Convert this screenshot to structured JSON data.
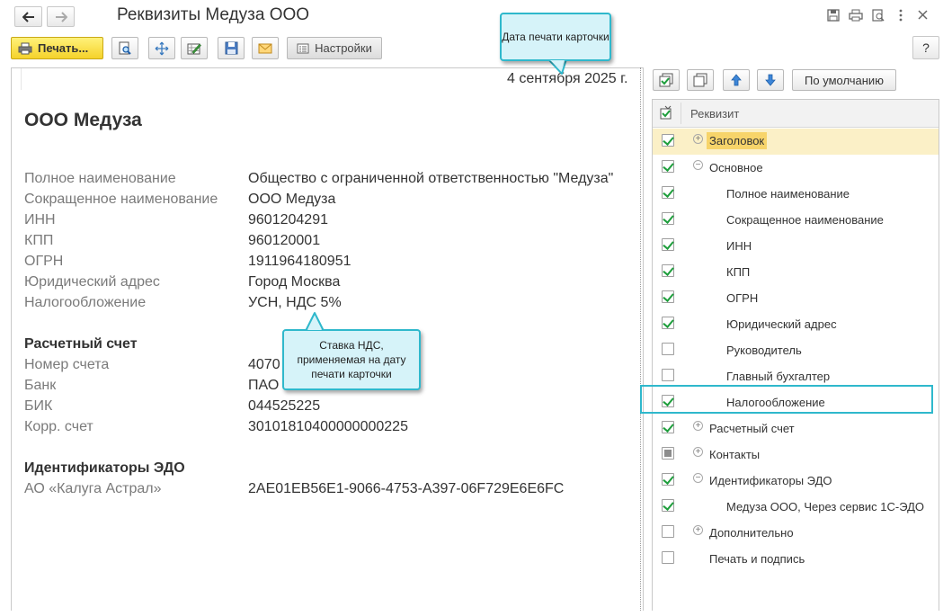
{
  "window": {
    "title": "Реквизиты Медуза ООО"
  },
  "toolbar": {
    "print_label": "Печать...",
    "settings_label": "Настройки",
    "help_label": "?"
  },
  "document": {
    "date": "4 сентября 2025 г.",
    "company": "ООО Медуза",
    "fields": [
      {
        "label": "Полное наименование",
        "value": "Общество с ограниченной ответственностью \"Медуза\""
      },
      {
        "label": "Сокращенное наименование",
        "value": "ООО Медуза"
      },
      {
        "label": "ИНН",
        "value": "9601204291"
      },
      {
        "label": "КПП",
        "value": "960120001"
      },
      {
        "label": "ОГРН",
        "value": "1911964180951"
      },
      {
        "label": "Юридический адрес",
        "value": "Город Москва"
      },
      {
        "label": "Налогообложение",
        "value": "УСН, НДС 5%"
      }
    ],
    "account_section": "Расчетный счет",
    "account_fields": [
      {
        "label": "Номер счета",
        "value": "4070"
      },
      {
        "label": "Банк",
        "value": "ПАО"
      },
      {
        "label": "БИК",
        "value": "044525225"
      },
      {
        "label": "Корр. счет",
        "value": "30101810400000000225"
      }
    ],
    "edo_section": "Идентификаторы ЭДО",
    "edo_fields": [
      {
        "label": "АО «Калуга Астрал»",
        "value": "2AE01EB56E1-9066-4753-A397-06F729E6E6FC"
      }
    ]
  },
  "callouts": {
    "date": "Дата печати карточки",
    "vat": "Ставка НДС, применяемая на дату печати карточки"
  },
  "panel": {
    "default_button": "По умолчанию",
    "column_header": "Реквизит",
    "rows": [
      {
        "label": "Заголовок",
        "check": "checked",
        "expander": "plus"
      },
      {
        "label": "Основное",
        "check": "checked",
        "expander": "minus"
      },
      {
        "label": "Полное наименование",
        "check": "checked",
        "expander": ""
      },
      {
        "label": "Сокращенное наименование",
        "check": "checked",
        "expander": ""
      },
      {
        "label": "ИНН",
        "check": "checked",
        "expander": ""
      },
      {
        "label": "КПП",
        "check": "checked",
        "expander": ""
      },
      {
        "label": "ОГРН",
        "check": "checked",
        "expander": ""
      },
      {
        "label": "Юридический адрес",
        "check": "checked",
        "expander": ""
      },
      {
        "label": "Руководитель",
        "check": "unchecked",
        "expander": ""
      },
      {
        "label": "Главный бухгалтер",
        "check": "unchecked",
        "expander": ""
      },
      {
        "label": "Налогообложение",
        "check": "checked",
        "expander": ""
      },
      {
        "label": "Расчетный счет",
        "check": "checked",
        "expander": "plus"
      },
      {
        "label": "Контакты",
        "check": "partial",
        "expander": "plus"
      },
      {
        "label": "Идентификаторы ЭДО",
        "check": "checked",
        "expander": "minus"
      },
      {
        "label": "Медуза ООО, Через сервис 1С-ЭДО",
        "check": "checked",
        "expander": ""
      },
      {
        "label": "Дополнительно",
        "check": "unchecked",
        "expander": "plus"
      },
      {
        "label": "Печать и подпись",
        "check": "unchecked",
        "expander": ""
      }
    ]
  },
  "colors": {
    "accent": "#2fb8cc",
    "print_button": "#f5d22a",
    "selected_row": "#fbf0c7",
    "check": "#1e9e3c"
  }
}
